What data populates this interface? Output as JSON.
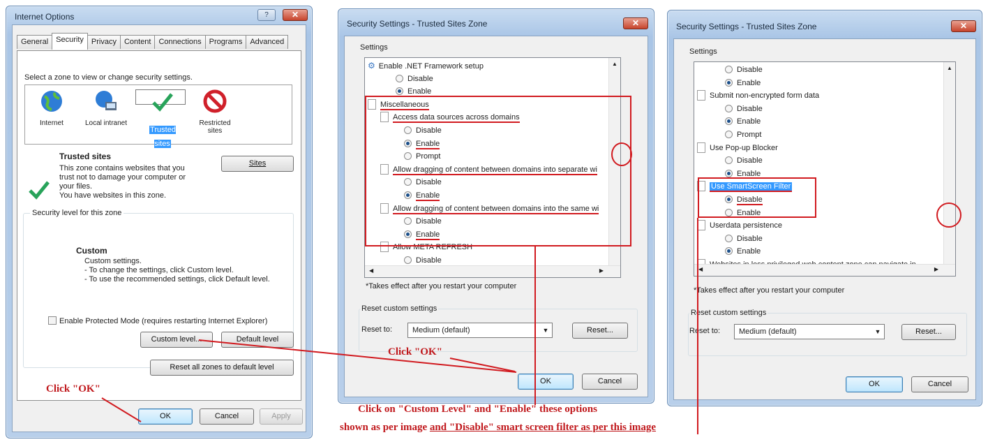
{
  "io": {
    "title": "Internet Options",
    "tabs": [
      "General",
      "Security",
      "Privacy",
      "Content",
      "Connections",
      "Programs",
      "Advanced"
    ],
    "zone_prompt": "Select a zone to view or change security settings.",
    "zones": [
      {
        "label": "Internet",
        "icon": "globe-icon"
      },
      {
        "label": "Local intranet",
        "icon": "intranet-icon"
      },
      {
        "label": "Trusted sites",
        "icon": "checkmark-icon"
      },
      {
        "label": "Restricted sites",
        "icon": "restricted-icon"
      }
    ],
    "zone_name": "Trusted sites",
    "zone_desc": [
      "This zone contains websites that you",
      "trust not to damage your computer or",
      "your files.",
      "You have websites in this zone."
    ],
    "sites_btn": "Sites",
    "level_group": "Security level for this zone",
    "level_name": "Custom",
    "level_desc": [
      "Custom settings.",
      "- To change the settings, click Custom level.",
      "- To use the recommended settings, click Default level."
    ],
    "protected_mode": "Enable Protected Mode (requires restarting Internet Explorer)",
    "custom_level_btn": "Custom level...",
    "default_level_btn": "Default level",
    "reset_all_btn": "Reset all zones to default level",
    "ok": "OK",
    "cancel": "Cancel",
    "apply": "Apply"
  },
  "ss1": {
    "title": "Security Settings - Trusted Sites Zone",
    "settings_label": "Settings",
    "items": [
      {
        "type": "header",
        "text": "Enable .NET Framework setup",
        "icon": "gear-icon"
      },
      {
        "type": "radio",
        "text": "Disable",
        "on": false
      },
      {
        "type": "radio",
        "text": "Enable",
        "on": true
      },
      {
        "type": "page",
        "text": "Miscellaneous"
      },
      {
        "type": "page",
        "text": "Access data sources across domains",
        "indent": true
      },
      {
        "type": "radio",
        "text": "Disable",
        "on": false
      },
      {
        "type": "radio",
        "text": "Enable",
        "on": true
      },
      {
        "type": "radio",
        "text": "Prompt",
        "on": false
      },
      {
        "type": "page",
        "text": "Allow dragging of content between domains into separate wi",
        "indent": true
      },
      {
        "type": "radio",
        "text": "Disable",
        "on": false
      },
      {
        "type": "radio",
        "text": "Enable",
        "on": true
      },
      {
        "type": "page",
        "text": "Allow dragging of content between domains into the same wi",
        "indent": true
      },
      {
        "type": "radio",
        "text": "Disable",
        "on": false
      },
      {
        "type": "radio",
        "text": "Enable",
        "on": true
      },
      {
        "type": "page",
        "text": "Allow META REFRESH",
        "indent": true
      },
      {
        "type": "radio",
        "text": "Disable",
        "on": false
      }
    ],
    "note": "*Takes effect after you restart your computer",
    "reset_group": "Reset custom settings",
    "reset_to": "Reset to:",
    "reset_value": "Medium (default)",
    "reset_btn": "Reset...",
    "ok": "OK",
    "cancel": "Cancel"
  },
  "ss2": {
    "title": "Security Settings - Trusted Sites Zone",
    "settings_label": "Settings",
    "items": [
      {
        "type": "radio",
        "text": "Disable",
        "on": false
      },
      {
        "type": "radio",
        "text": "Enable",
        "on": true
      },
      {
        "type": "page",
        "text": "Submit non-encrypted form data"
      },
      {
        "type": "radio",
        "text": "Disable",
        "on": false
      },
      {
        "type": "radio",
        "text": "Enable",
        "on": true
      },
      {
        "type": "radio",
        "text": "Prompt",
        "on": false
      },
      {
        "type": "page",
        "text": "Use Pop-up Blocker"
      },
      {
        "type": "radio",
        "text": "Disable",
        "on": false
      },
      {
        "type": "radio",
        "text": "Enable",
        "on": true
      },
      {
        "type": "page",
        "text": "Use SmartScreen Filter",
        "highlight": true
      },
      {
        "type": "radio",
        "text": "Disable",
        "on": true
      },
      {
        "type": "radio",
        "text": "Enable",
        "on": false
      },
      {
        "type": "page",
        "text": "Userdata persistence"
      },
      {
        "type": "radio",
        "text": "Disable",
        "on": false
      },
      {
        "type": "radio",
        "text": "Enable",
        "on": true
      },
      {
        "type": "page",
        "text": "Websites in less privileged web content zone can navigate in"
      }
    ],
    "note": "*Takes effect after you restart your computer",
    "reset_group": "Reset custom settings",
    "reset_to": "Reset to:",
    "reset_value": "Medium (default)",
    "reset_btn": "Reset...",
    "ok": "OK",
    "cancel": "Cancel"
  },
  "annotations": {
    "click_ok_1": "Click \"OK\"",
    "click_ok_2": "Click \"OK\"",
    "instr_line1": "Click on \"Custom Level\" and \"Enable\" these options",
    "instr_line2a": "shown as per image ",
    "instr_line2b": "and \"Disable\" smart screen filter as per this image",
    "accent_red": "#d11a1f"
  }
}
